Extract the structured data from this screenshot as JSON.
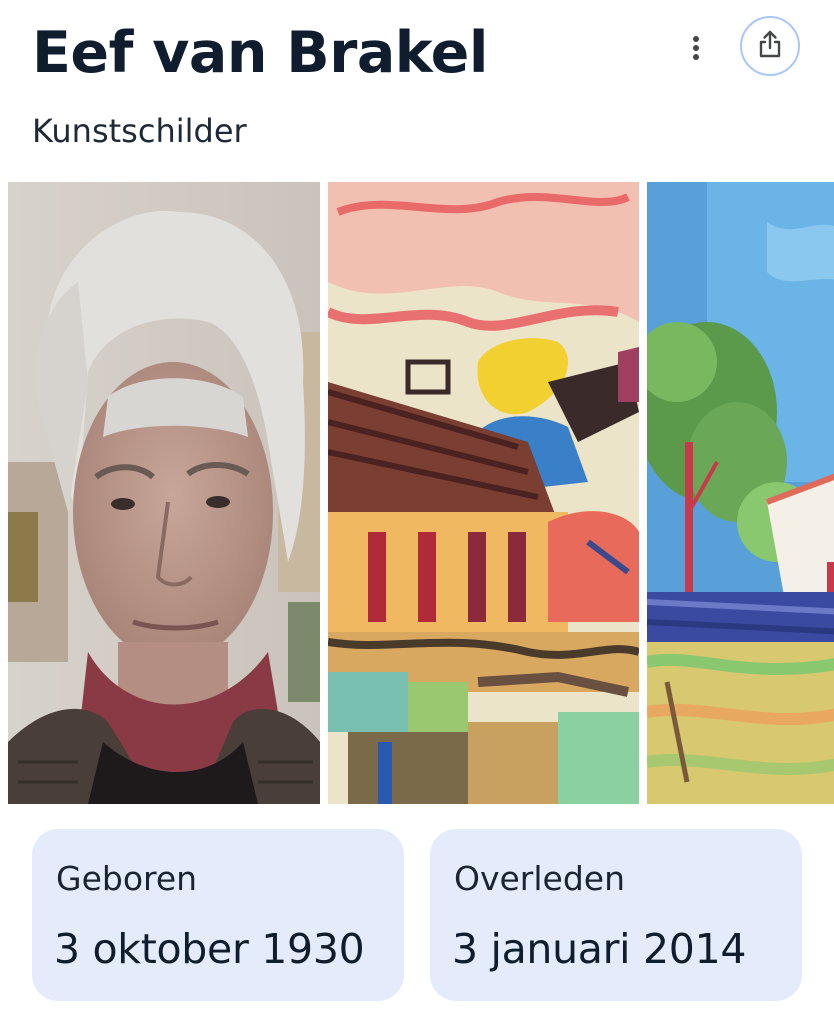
{
  "header": {
    "title": "Eef van Brakel",
    "subtitle": "Kunstschilder",
    "more_icon": "more-vert-icon",
    "share_icon": "share-icon"
  },
  "gallery": {
    "images": [
      {
        "subject": "portrait photo of an elderly man with white hair"
      },
      {
        "subject": "watercolor painting of houses and figures"
      },
      {
        "subject": "painting of trees and a house under blue sky"
      }
    ]
  },
  "facts": [
    {
      "label": "Geboren",
      "value": "3 oktober 1930"
    },
    {
      "label": "Overleden",
      "value": "3 januari 2014"
    }
  ],
  "colors": {
    "card_bg": "#e4ecfb",
    "share_border": "#a8c7fa",
    "title": "#0f1d2e"
  }
}
